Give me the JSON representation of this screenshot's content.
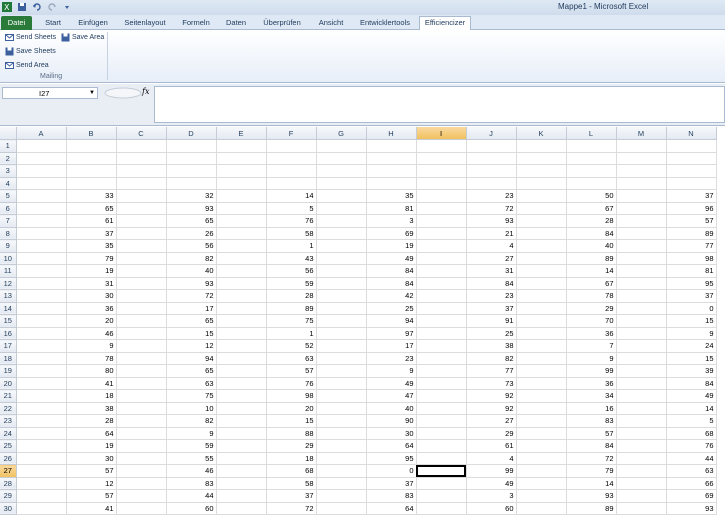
{
  "titlebar": {
    "title": "Mappe1 - Microsoft Excel"
  },
  "tabs": [
    {
      "label": "Datei"
    },
    {
      "label": "Start"
    },
    {
      "label": "Einfügen"
    },
    {
      "label": "Seitenlayout"
    },
    {
      "label": "Formeln"
    },
    {
      "label": "Daten"
    },
    {
      "label": "Überprüfen"
    },
    {
      "label": "Ansicht"
    },
    {
      "label": "Entwicklertools"
    },
    {
      "label": "Efficiencizer"
    }
  ],
  "ribbon": {
    "send_sheets": "Send Sheets",
    "save_area": "Save Area",
    "save_sheets": "Save Sheets",
    "send_area": "Send Area",
    "group_label": "Mailing"
  },
  "formula_bar": {
    "name_box": "I27",
    "fx": "fx",
    "formula": ""
  },
  "grid": {
    "columns": [
      "A",
      "B",
      "C",
      "D",
      "E",
      "F",
      "G",
      "H",
      "I",
      "J",
      "K",
      "L",
      "M",
      "N"
    ],
    "selected_column": "I",
    "selected_row": 27,
    "rows": [
      {
        "n": 1,
        "cells": {}
      },
      {
        "n": 2,
        "cells": {}
      },
      {
        "n": 3,
        "cells": {}
      },
      {
        "n": 4,
        "cells": {}
      },
      {
        "n": 5,
        "cells": {
          "B": "33",
          "D": "32",
          "F": "14",
          "H": "35",
          "J": "23",
          "L": "50",
          "N": "37"
        }
      },
      {
        "n": 6,
        "cells": {
          "B": "65",
          "D": "93",
          "F": "5",
          "H": "81",
          "J": "72",
          "L": "67",
          "N": "96"
        }
      },
      {
        "n": 7,
        "cells": {
          "B": "61",
          "D": "65",
          "F": "76",
          "H": "3",
          "J": "93",
          "L": "28",
          "N": "57"
        }
      },
      {
        "n": 8,
        "cells": {
          "B": "37",
          "D": "26",
          "F": "58",
          "H": "69",
          "J": "21",
          "L": "84",
          "N": "89"
        }
      },
      {
        "n": 9,
        "cells": {
          "B": "35",
          "D": "56",
          "F": "1",
          "H": "19",
          "J": "4",
          "L": "40",
          "N": "77"
        }
      },
      {
        "n": 10,
        "cells": {
          "B": "79",
          "D": "82",
          "F": "43",
          "H": "49",
          "J": "27",
          "L": "89",
          "N": "98"
        }
      },
      {
        "n": 11,
        "cells": {
          "B": "19",
          "D": "40",
          "F": "56",
          "H": "84",
          "J": "31",
          "L": "14",
          "N": "81"
        }
      },
      {
        "n": 12,
        "cells": {
          "B": "31",
          "D": "93",
          "F": "59",
          "H": "84",
          "J": "84",
          "L": "67",
          "N": "95"
        }
      },
      {
        "n": 13,
        "cells": {
          "B": "30",
          "D": "72",
          "F": "28",
          "H": "42",
          "J": "23",
          "L": "78",
          "N": "37"
        }
      },
      {
        "n": 14,
        "cells": {
          "B": "36",
          "D": "17",
          "F": "89",
          "H": "25",
          "J": "37",
          "L": "29",
          "N": "0"
        }
      },
      {
        "n": 15,
        "cells": {
          "B": "20",
          "D": "65",
          "F": "75",
          "H": "94",
          "J": "91",
          "L": "70",
          "N": "15"
        }
      },
      {
        "n": 16,
        "cells": {
          "B": "46",
          "D": "15",
          "F": "1",
          "H": "97",
          "J": "25",
          "L": "36",
          "N": "9"
        }
      },
      {
        "n": 17,
        "cells": {
          "B": "9",
          "D": "12",
          "F": "52",
          "H": "17",
          "J": "38",
          "L": "7",
          "N": "24"
        }
      },
      {
        "n": 18,
        "cells": {
          "B": "78",
          "D": "94",
          "F": "63",
          "H": "23",
          "J": "82",
          "L": "9",
          "N": "15"
        }
      },
      {
        "n": 19,
        "cells": {
          "B": "80",
          "D": "65",
          "F": "57",
          "H": "9",
          "J": "77",
          "L": "99",
          "N": "39"
        }
      },
      {
        "n": 20,
        "cells": {
          "B": "41",
          "D": "63",
          "F": "76",
          "H": "49",
          "J": "73",
          "L": "36",
          "N": "84"
        }
      },
      {
        "n": 21,
        "cells": {
          "B": "18",
          "D": "75",
          "F": "98",
          "H": "47",
          "J": "92",
          "L": "34",
          "N": "49"
        }
      },
      {
        "n": 22,
        "cells": {
          "B": "38",
          "D": "10",
          "F": "20",
          "H": "40",
          "J": "92",
          "L": "16",
          "N": "14"
        }
      },
      {
        "n": 23,
        "cells": {
          "B": "28",
          "D": "82",
          "F": "15",
          "H": "90",
          "J": "27",
          "L": "83",
          "N": "5"
        }
      },
      {
        "n": 24,
        "cells": {
          "B": "64",
          "D": "9",
          "F": "88",
          "H": "30",
          "J": "29",
          "L": "57",
          "N": "68"
        }
      },
      {
        "n": 25,
        "cells": {
          "B": "19",
          "D": "59",
          "F": "29",
          "H": "64",
          "J": "61",
          "L": "84",
          "N": "76"
        }
      },
      {
        "n": 26,
        "cells": {
          "B": "30",
          "D": "55",
          "F": "18",
          "H": "95",
          "J": "4",
          "L": "72",
          "N": "44"
        }
      },
      {
        "n": 27,
        "cells": {
          "B": "57",
          "D": "46",
          "F": "68",
          "H": "0",
          "J": "99",
          "L": "79",
          "N": "63"
        }
      },
      {
        "n": 28,
        "cells": {
          "B": "12",
          "D": "83",
          "F": "58",
          "H": "37",
          "J": "49",
          "L": "14",
          "N": "66"
        }
      },
      {
        "n": 29,
        "cells": {
          "B": "57",
          "D": "44",
          "F": "37",
          "H": "83",
          "J": "3",
          "L": "93",
          "N": "69"
        }
      },
      {
        "n": 30,
        "cells": {
          "B": "41",
          "D": "60",
          "F": "72",
          "H": "64",
          "J": "60",
          "L": "89",
          "N": "93"
        }
      }
    ]
  }
}
